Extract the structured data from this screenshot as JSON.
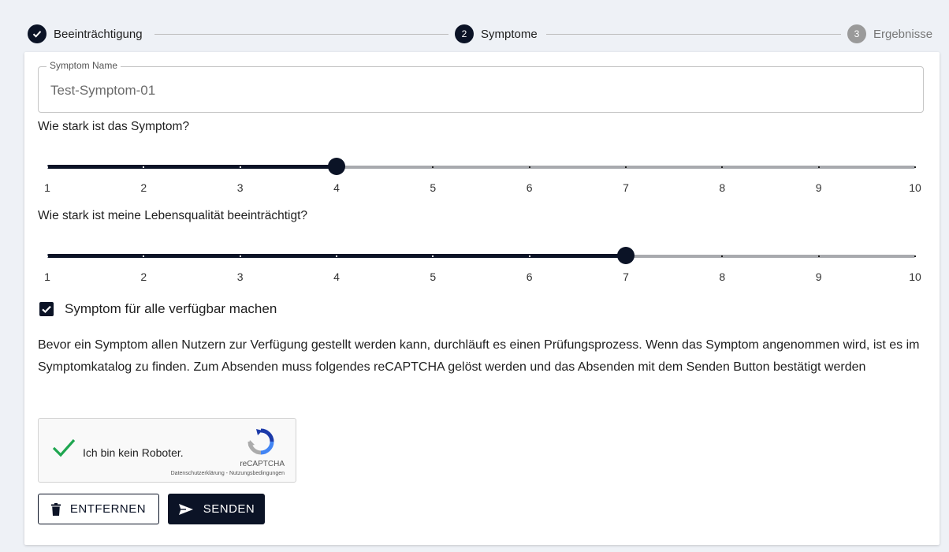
{
  "stepper": {
    "steps": [
      {
        "label": "Beeinträchtigung",
        "number": "",
        "state": "done"
      },
      {
        "label": "Symptome",
        "number": "2",
        "state": "active"
      },
      {
        "label": "Ergebnisse",
        "number": "3",
        "state": "pending"
      }
    ]
  },
  "form": {
    "symptom_name": {
      "label": "Symptom Name",
      "value": "Test-Symptom-01"
    },
    "severity": {
      "question": "Wie stark ist das Symptom?",
      "value": 4,
      "min": 1,
      "max": 10,
      "tick_labels": [
        "1",
        "2",
        "3",
        "4",
        "5",
        "6",
        "7",
        "8",
        "9",
        "10"
      ]
    },
    "quality_of_life": {
      "question": "Wie stark ist meine Lebensqualität beeinträchtigt?",
      "value": 7,
      "min": 1,
      "max": 10,
      "tick_labels": [
        "1",
        "2",
        "3",
        "4",
        "5",
        "6",
        "7",
        "8",
        "9",
        "10"
      ]
    },
    "share_checkbox": {
      "label": "Symptom für alle verfügbar machen",
      "checked": true
    },
    "info_text": "Bevor ein Symptom allen Nutzern zur Verfügung gestellt werden kann, durchläuft es einen Prüfungsprozess. Wenn das Symptom angenommen wird, ist es im Symptomkatalog zu finden. Zum Absenden muss folgendes reCAPTCHA gelöst werden und das Absenden mit dem Senden Button bestätigt werden"
  },
  "recaptcha": {
    "label": "Ich bin kein Roboter.",
    "brand": "reCAPTCHA",
    "links": "Datenschutzerklärung - Nutzungsbedingungen",
    "checked": true
  },
  "buttons": {
    "remove_label": "ENTFERNEN",
    "send_label": "SENDEN"
  },
  "colors": {
    "primary": "#0b1326",
    "track_inactive": "#a8aaae",
    "recaptcha_check": "#1fa650",
    "step_pending": "#9a9a9a"
  }
}
